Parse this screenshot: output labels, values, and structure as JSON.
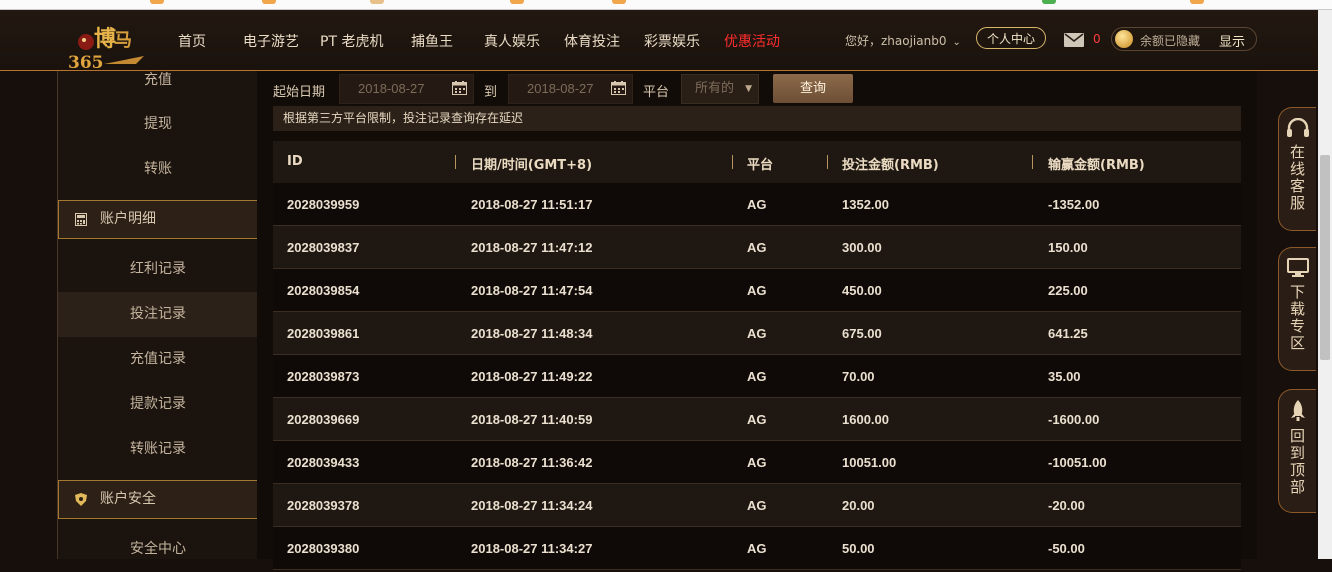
{
  "nav": {
    "items": [
      "首页",
      "电子游艺",
      "PT 老虎机",
      "捕鱼王",
      "真人娱乐",
      "体育投注",
      "彩票娱乐"
    ],
    "promo": "优惠活动",
    "greeting": "您好，zhaojianb0",
    "center_button": "个人中心",
    "mail_count": "0",
    "balance_hidden": "余额已隐藏",
    "show_button": "显示"
  },
  "sidebar": {
    "top_items": [
      "充值",
      "提现",
      "转账"
    ],
    "account_details_header": "账户明细",
    "detail_items": [
      "红利记录",
      "投注记录",
      "充值记录",
      "提款记录",
      "转账记录"
    ],
    "active_item": "投注记录",
    "security_header": "账户安全",
    "security_items": [
      "安全中心"
    ]
  },
  "filter": {
    "start_label": "起始日期",
    "start_date": "2018-08-27",
    "to_label": "到",
    "end_date": "2018-08-27",
    "platform_label": "平台",
    "platform_value": "所有的",
    "query_button": "查询"
  },
  "notice": "根据第三方平台限制，投注记录查询存在延迟",
  "table": {
    "headers": [
      "ID",
      "日期/时间(GMT+8)",
      "平台",
      "投注金额(RMB)",
      "输赢金额(RMB)"
    ],
    "rows": [
      [
        "2028039959",
        "2018-08-27 11:51:17",
        "AG",
        "1352.00",
        "-1352.00"
      ],
      [
        "2028039837",
        "2018-08-27 11:47:12",
        "AG",
        "300.00",
        "150.00"
      ],
      [
        "2028039854",
        "2018-08-27 11:47:54",
        "AG",
        "450.00",
        "225.00"
      ],
      [
        "2028039861",
        "2018-08-27 11:48:34",
        "AG",
        "675.00",
        "641.25"
      ],
      [
        "2028039873",
        "2018-08-27 11:49:22",
        "AG",
        "70.00",
        "35.00"
      ],
      [
        "2028039669",
        "2018-08-27 11:40:59",
        "AG",
        "1600.00",
        "-1600.00"
      ],
      [
        "2028039433",
        "2018-08-27 11:36:42",
        "AG",
        "10051.00",
        "-10051.00"
      ],
      [
        "2028039378",
        "2018-08-27 11:34:24",
        "AG",
        "20.00",
        "-20.00"
      ],
      [
        "2028039380",
        "2018-08-27 11:34:27",
        "AG",
        "50.00",
        "-50.00"
      ]
    ]
  },
  "float_widgets": [
    {
      "icon": "headset-icon",
      "label": "在线客服"
    },
    {
      "icon": "monitor-icon",
      "label": "下载专区"
    },
    {
      "icon": "rocket-icon",
      "label": "回到顶部"
    }
  ],
  "colors": {
    "accent_gold": "#b8742c",
    "promo_red": "#ff2d2d",
    "background": "#160f0b"
  }
}
